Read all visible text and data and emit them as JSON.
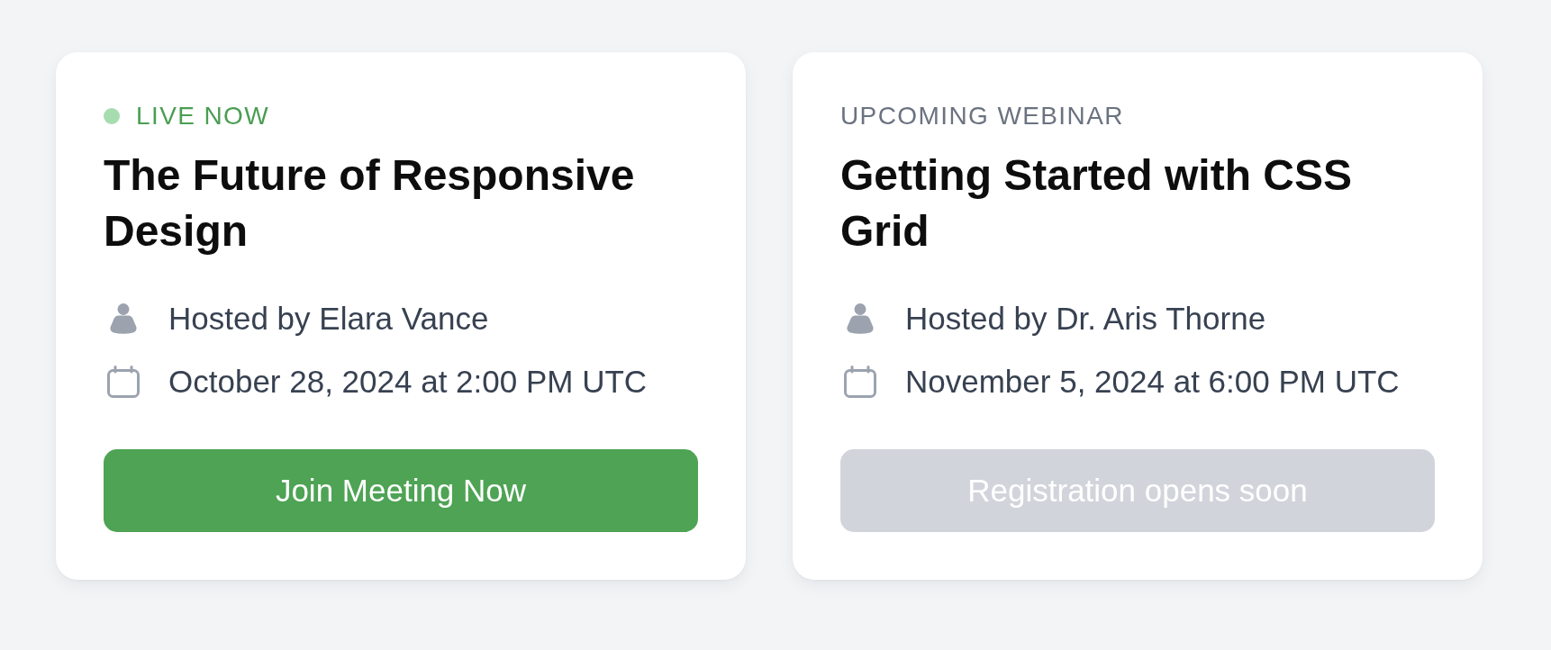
{
  "cards": [
    {
      "live": true,
      "status": "LIVE NOW",
      "title": "The Future of Responsive Design",
      "details": [
        {
          "kind": "host",
          "text": "Hosted by Elara Vance"
        },
        {
          "kind": "date",
          "text": "October 28, 2024 at 2:00 PM UTC"
        }
      ],
      "button": {
        "label": "Join Meeting Now",
        "disabled": false
      }
    },
    {
      "live": false,
      "status": "UPCOMING WEBINAR",
      "title": "Getting Started with CSS Grid",
      "details": [
        {
          "kind": "host",
          "text": "Hosted by Dr. Aris Thorne"
        },
        {
          "kind": "date",
          "text": "November 5, 2024 at 6:00 PM UTC"
        }
      ],
      "button": {
        "label": "Registration opens soon",
        "disabled": true
      }
    }
  ]
}
